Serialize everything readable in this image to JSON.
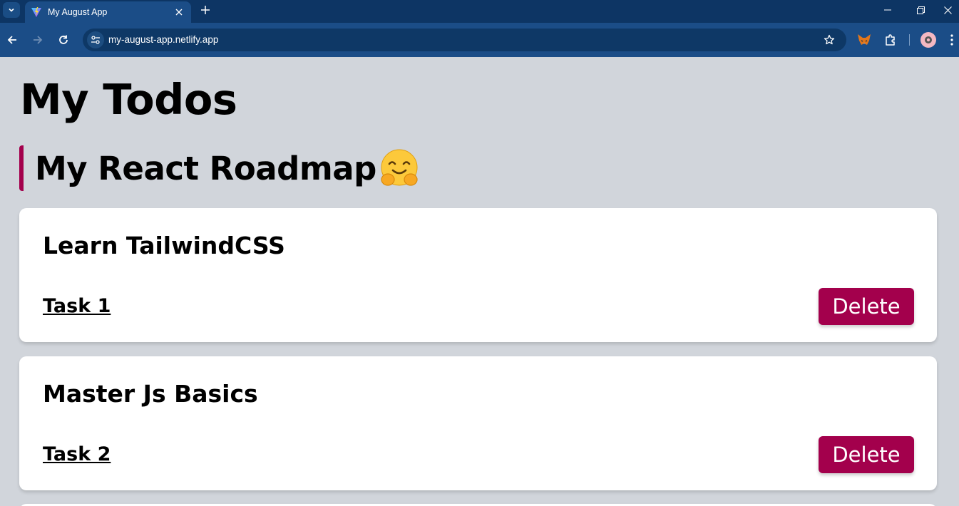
{
  "browser": {
    "tab_title": "My August App",
    "url": "my-august-app.netlify.app"
  },
  "page": {
    "title": "My Todos",
    "section_title": "My React Roadmap"
  },
  "todos": [
    {
      "title": "Learn TailwindCSS",
      "task": "Task 1",
      "delete_label": "Delete"
    },
    {
      "title": "Master Js Basics",
      "task": "Task 2",
      "delete_label": "Delete"
    }
  ],
  "colors": {
    "accent": "#a3004c",
    "page_background": "#d1d5db",
    "chrome_dark": "#0d3564",
    "chrome_toolbar": "#1b4d87"
  },
  "icons": {
    "section_emoji": "hugging-face-emoji"
  }
}
